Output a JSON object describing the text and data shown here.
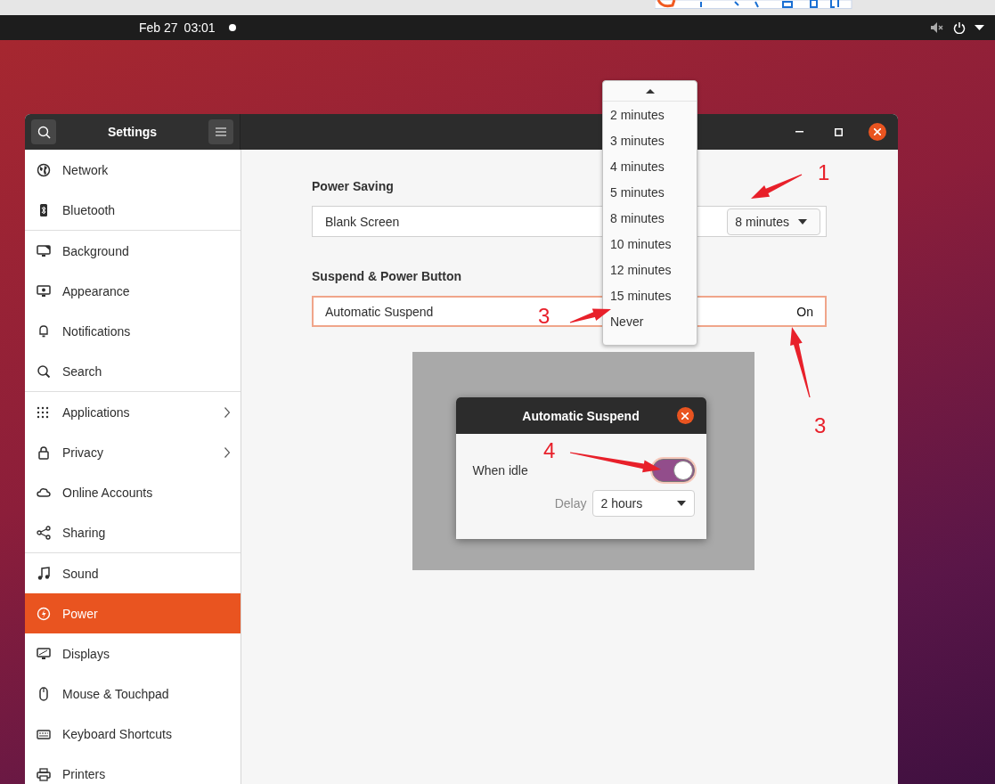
{
  "top_bar": {
    "date": "Feb 27",
    "time": "03:01"
  },
  "window": {
    "title": "Settings"
  },
  "sidebar": {
    "groups": [
      [
        {
          "label": "Network",
          "selected": false
        },
        {
          "label": "Bluetooth",
          "selected": false
        }
      ],
      [
        {
          "label": "Background",
          "selected": false
        },
        {
          "label": "Appearance",
          "selected": false
        },
        {
          "label": "Notifications",
          "selected": false
        },
        {
          "label": "Search",
          "selected": false
        }
      ],
      [
        {
          "label": "Applications",
          "selected": false,
          "chevron": true
        },
        {
          "label": "Privacy",
          "selected": false,
          "chevron": true
        },
        {
          "label": "Online Accounts",
          "selected": false
        },
        {
          "label": "Sharing",
          "selected": false
        }
      ],
      [
        {
          "label": "Sound",
          "selected": false
        },
        {
          "label": "Power",
          "selected": true
        },
        {
          "label": "Displays",
          "selected": false
        },
        {
          "label": "Mouse & Touchpad",
          "selected": false
        },
        {
          "label": "Keyboard Shortcuts",
          "selected": false
        },
        {
          "label": "Printers",
          "selected": false
        }
      ]
    ]
  },
  "panel": {
    "sections": [
      {
        "title": "Power Saving",
        "rows": [
          {
            "label": "Blank Screen",
            "kind": "dropdown",
            "value": "8 minutes",
            "highlighted": false
          }
        ]
      },
      {
        "title": "Suspend & Power Button",
        "rows": [
          {
            "label": "Automatic Suspend",
            "kind": "status",
            "value": "On",
            "highlighted": true
          }
        ]
      }
    ]
  },
  "popup": {
    "options": [
      "2 minutes",
      "3 minutes",
      "4 minutes",
      "5 minutes",
      "8 minutes",
      "10 minutes",
      "12 minutes",
      "15 minutes",
      "Never"
    ]
  },
  "dialog": {
    "title": "Automatic Suspend",
    "when_idle": {
      "label": "When idle",
      "on": true
    },
    "delay": {
      "label": "Delay",
      "value": "2 hours"
    }
  },
  "annotations": [
    {
      "label": "1"
    },
    {
      "label": "3"
    },
    {
      "label": "3"
    },
    {
      "label": "4"
    }
  ]
}
